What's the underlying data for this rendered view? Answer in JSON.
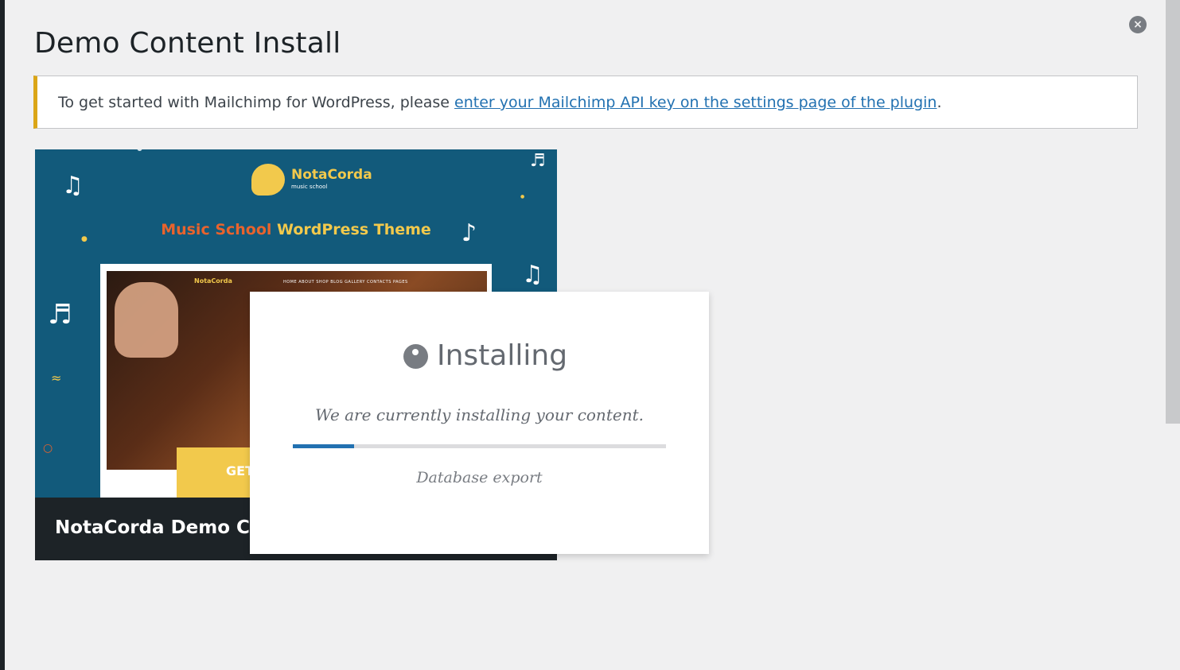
{
  "page": {
    "title": "Demo Content Install",
    "close_label": "×"
  },
  "notice": {
    "text_before": "To get started with Mailchimp for WordPress, please ",
    "link_text": "enter your Mailchimp API key on the settings page of the plugin",
    "text_after": "."
  },
  "demo": {
    "name": "NotaCorda Demo Content",
    "preview": {
      "logo_name": "NotaCorda",
      "logo_tagline": "music school",
      "hero_part1": "Music School",
      "hero_part2": " WordPress Theme",
      "mock_logo": "NotaCorda",
      "mock_nav": "HOME  ABOUT  SHOP  BLOG  GALLERY  CONTACTS  PAGES",
      "mock_cta": "GET"
    }
  },
  "modal": {
    "title": "Installing",
    "message": "We are currently installing your content.",
    "progress_fraction": 0.165,
    "step": "Database export"
  },
  "colors": {
    "accent": "#2271b1",
    "notice_border": "#dba617",
    "preview_bg": "#125a7b"
  }
}
